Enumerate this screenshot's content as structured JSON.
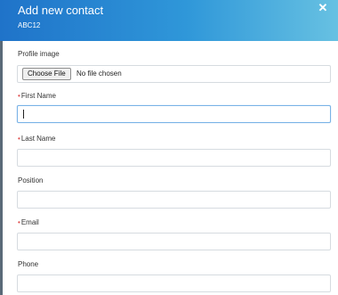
{
  "header": {
    "title": "Add new contact",
    "subtitle": "ABC12",
    "close_icon": "close-icon",
    "gradient_colors": [
      "#1f73c9",
      "#2f97d9",
      "#67c1e2"
    ]
  },
  "form": {
    "profile_image": {
      "label": "Profile image",
      "button_label": "Choose File",
      "status": "No file chosen"
    },
    "first_name": {
      "label": "First Name",
      "required_mark": "•",
      "value": ""
    },
    "last_name": {
      "label": "Last Name",
      "required_mark": "•",
      "value": ""
    },
    "position": {
      "label": "Position",
      "value": ""
    },
    "email": {
      "label": "Email",
      "required_mark": "•",
      "value": ""
    },
    "phone": {
      "label": "Phone",
      "value": ""
    }
  },
  "colors": {
    "required": "#e04a4a",
    "focus_border": "#7ab3e6"
  }
}
